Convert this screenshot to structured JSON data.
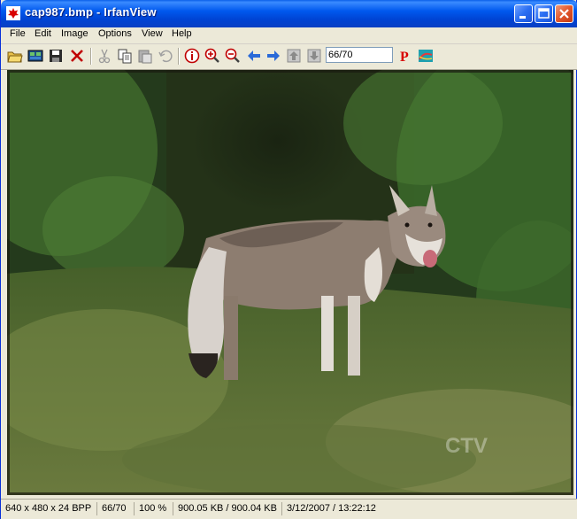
{
  "window": {
    "title": "cap987.bmp - IrfanView"
  },
  "menu": [
    "File",
    "Edit",
    "Image",
    "Options",
    "View",
    "Help"
  ],
  "toolbar": {
    "page_value": "66/70",
    "icons": [
      "open-folder-icon",
      "thumbnails-icon",
      "save-icon",
      "delete-icon",
      "cut-icon",
      "copy-icon",
      "paste-icon",
      "undo-icon",
      "info-icon",
      "zoom-in-icon",
      "zoom-out-icon",
      "previous-icon",
      "next-icon",
      "first-icon",
      "last-icon",
      "slideshow-icon",
      "irfanview-logo-icon"
    ]
  },
  "image": {
    "description": "",
    "watermark": "CTV"
  },
  "status": {
    "dimensions": "640 x 480 x 24 BPP",
    "index": "66/70",
    "zoom": "100 %",
    "filesize": "900.05 KB / 900.04 KB",
    "datetime": "3/12/2007 / 13:22:12"
  },
  "colors": {
    "titlebar": "#0058ee",
    "chrome": "#ece9d8",
    "close_button": "#e2572c"
  }
}
